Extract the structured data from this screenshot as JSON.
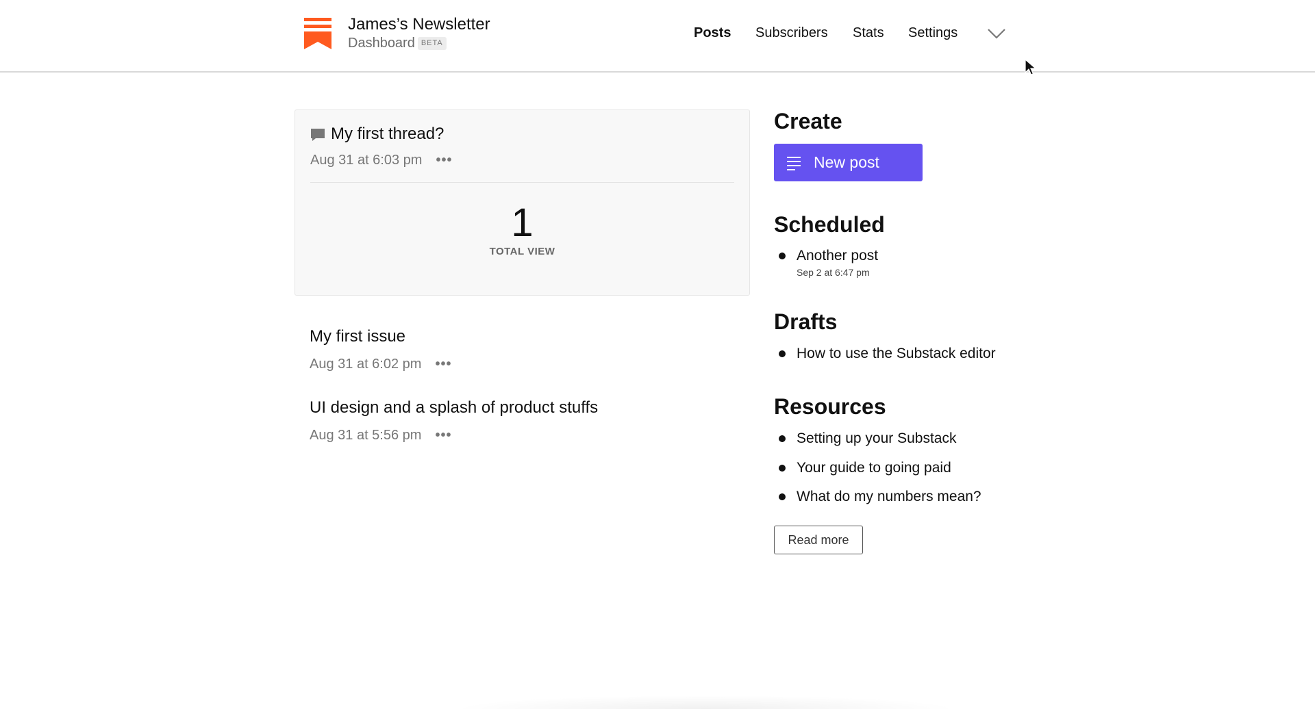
{
  "header": {
    "newsletter_name": "James’s Newsletter",
    "subtitle": "Dashboard",
    "beta_badge": "BETA",
    "brand_color": "#ff5a1f",
    "logo_icon": "substack-logo-icon",
    "nav": {
      "posts": "Posts",
      "subscribers": "Subscribers",
      "stats": "Stats",
      "settings": "Settings",
      "more_icon": "chevron-down-icon"
    },
    "active_tab": "Posts"
  },
  "thread_card": {
    "icon": "comment-icon",
    "title": "My first thread?",
    "date": "Aug 31 at 6:03 pm",
    "more_label": "•••",
    "total_views": "1",
    "total_label": "TOTAL VIEW"
  },
  "posts": [
    {
      "title": "My first issue",
      "date": "Aug 31 at 6:02 pm",
      "more_label": "•••"
    },
    {
      "title": "UI design and a splash of product stuffs",
      "date": "Aug 31 at 5:56 pm",
      "more_label": "•••"
    }
  ],
  "sidebar": {
    "create": {
      "heading": "Create",
      "new_post_label": "New post",
      "new_post_icon": "text-lines-icon",
      "button_color": "#6552f0"
    },
    "scheduled": {
      "heading": "Scheduled",
      "items": [
        {
          "title": "Another post",
          "date": "Sep 2 at 6:47 pm"
        }
      ]
    },
    "drafts": {
      "heading": "Drafts",
      "items": [
        {
          "title": "How to use the Substack editor"
        }
      ]
    },
    "resources": {
      "heading": "Resources",
      "items": [
        {
          "title": "Setting up your Substack"
        },
        {
          "title": "Your guide to going paid"
        },
        {
          "title": "What do my numbers mean?"
        }
      ],
      "read_more_label": "Read more"
    }
  }
}
